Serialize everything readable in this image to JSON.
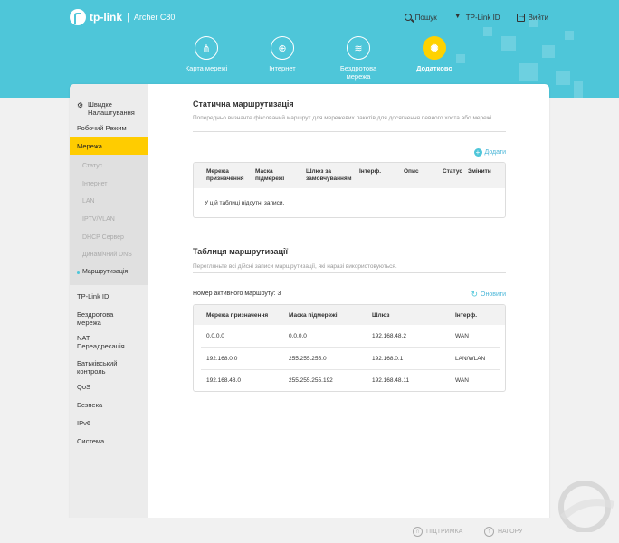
{
  "brand": {
    "logo": "tp-link",
    "separator": "|",
    "model": "Archer C80"
  },
  "top_actions": {
    "search": "Пошук",
    "cloud": "TP-Link ID",
    "logout": "Вийти"
  },
  "nav": [
    {
      "label": "Карта мережі",
      "icon": "network-map-icon"
    },
    {
      "label": "Інтернет",
      "icon": "globe-icon"
    },
    {
      "label": "Бездротова мережа",
      "icon": "wifi-icon"
    },
    {
      "label": "Додатково",
      "icon": "gear-icon",
      "active": true
    }
  ],
  "sidebar": {
    "quick_setup": "Швидке Налаштування",
    "work_mode": "Робочий Режим",
    "network": "Мережа",
    "network_sub": [
      "Статус",
      "Інтернет",
      "LAN",
      "IPTV/VLAN",
      "DHCP Сервер",
      "Динамічний DNS",
      "Маршрутизація"
    ],
    "items": [
      "TP-Link ID",
      "Бездротова мережа",
      "NAT Переадресація",
      "Батьківський контроль",
      "QoS",
      "Безпека",
      "IPv6",
      "Система"
    ]
  },
  "static_routing": {
    "title": "Статична маршрутизація",
    "description": "Попередньо визначте фіксований маршрут для мережевих пакетів для досягнення певного хоста або мережі.",
    "add": "Додати",
    "columns": [
      "Мережа призначення",
      "Маска підмережі",
      "Шлюз за замовчуванням",
      "Інтерф.",
      "Опис",
      "Статус",
      "Змінити"
    ],
    "empty": "У цій таблиці відсутні записи."
  },
  "routing_table": {
    "title": "Таблиця маршрутизації",
    "description": "Перегляньте всі дійсні записи маршрутизації, які наразі використовуються.",
    "active_label": "Номер активного маршруту: 3",
    "refresh": "Оновити",
    "columns": [
      "Мережа призначення",
      "Маска підмережі",
      "Шлюз",
      "Інтерф."
    ],
    "rows": [
      [
        "0.0.0.0",
        "0.0.0.0",
        "192.168.48.2",
        "WAN"
      ],
      [
        "192.168.0.0",
        "255.255.255.0",
        "192.168.0.1",
        "LAN/WLAN"
      ],
      [
        "192.168.48.0",
        "255.255.255.192",
        "192.168.48.11",
        "WAN"
      ]
    ]
  },
  "footer": {
    "support": "ПІДТРИМКА",
    "top": "НАГОРУ"
  },
  "colors": {
    "header": "#4ec6d9",
    "accent": "#ffcc00",
    "link": "#4ab6d8"
  }
}
